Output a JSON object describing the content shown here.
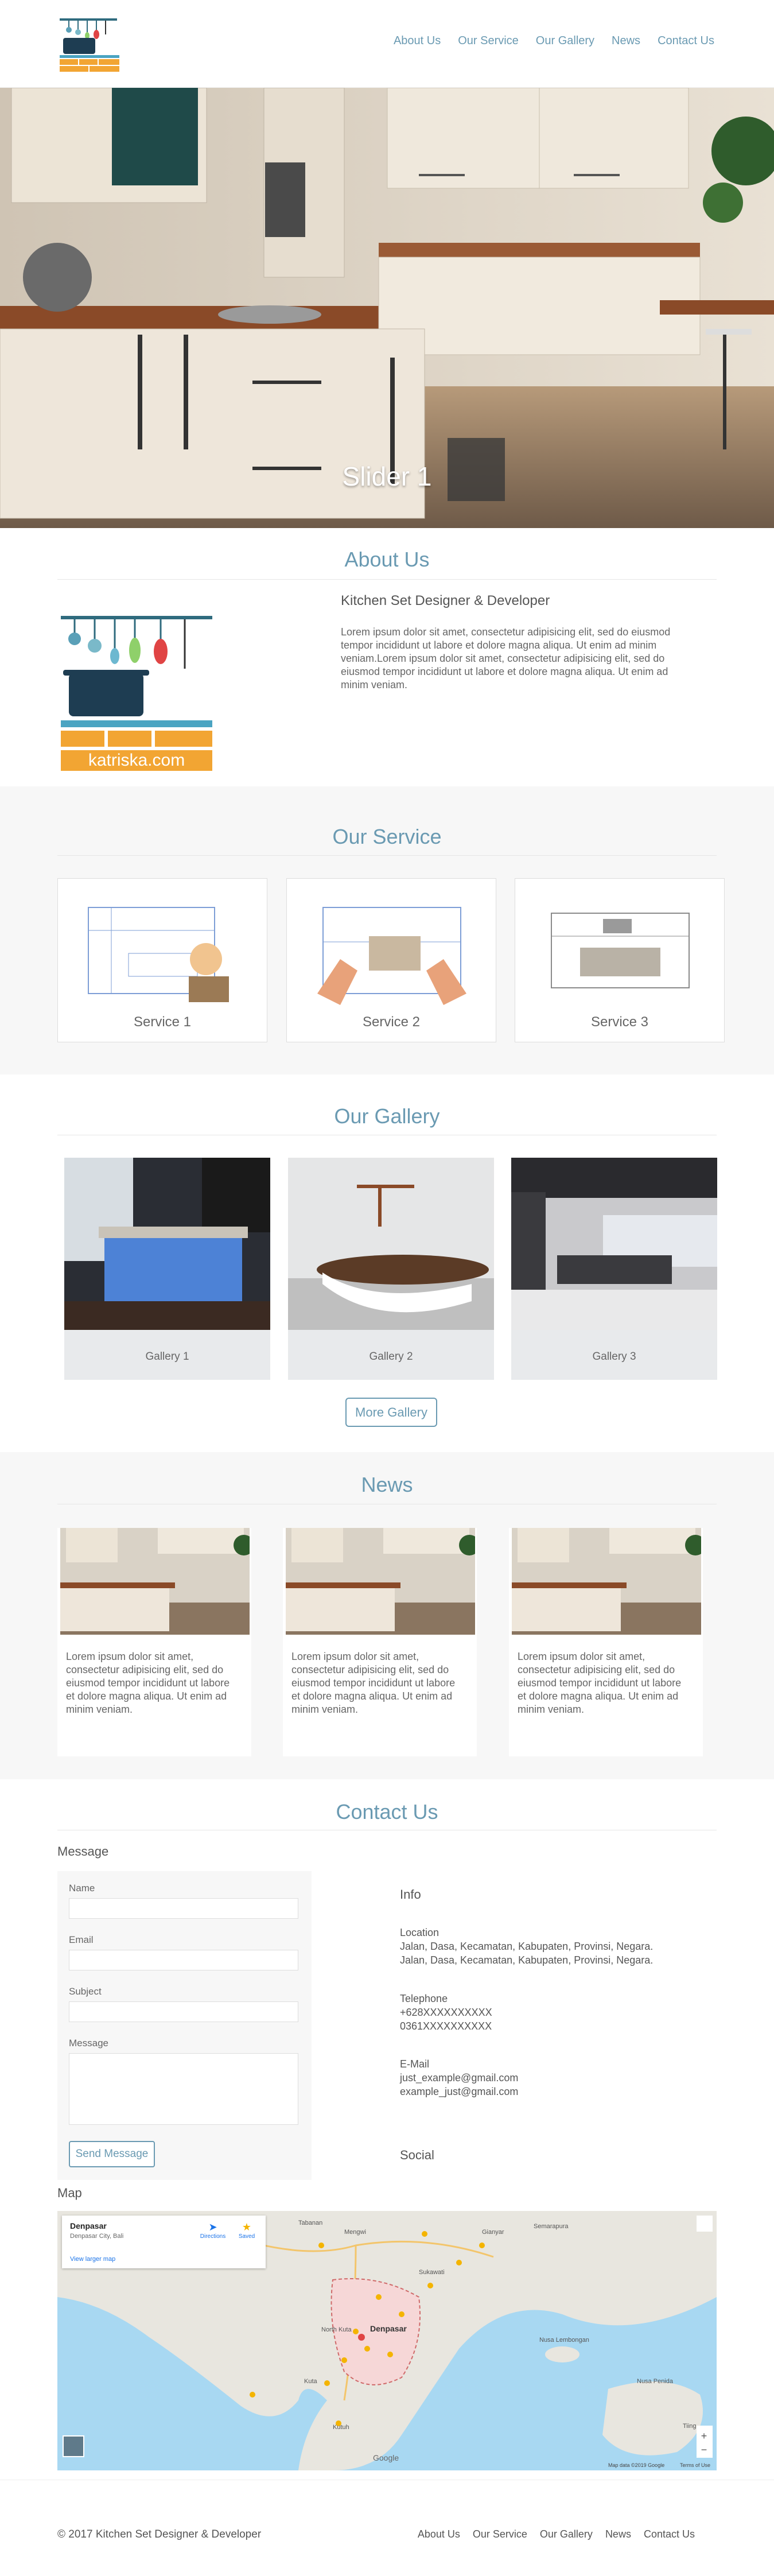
{
  "nav": {
    "items": [
      "About Us",
      "Our Service",
      "Our Gallery",
      "News",
      "Contact Us"
    ]
  },
  "hero": {
    "caption": "Slider 1"
  },
  "about": {
    "title": "About Us",
    "heading": "Kitchen Set Designer & Developer",
    "text": "Lorem ipsum dolor sit amet, consectetur adipisicing elit, sed do eiusmod tempor incididunt ut labore et dolore magna aliqua. Ut enim ad minim veniam.Lorem ipsum dolor sit amet, consectetur adipisicing elit, sed do eiusmod tempor incididunt ut labore et dolore magna aliqua. Ut enim ad minim veniam.",
    "logo_text": "katriska.com"
  },
  "service": {
    "title": "Our Service",
    "items": [
      "Service 1",
      "Service 2",
      "Service 3"
    ]
  },
  "gallery": {
    "title": "Our Gallery",
    "items": [
      "Gallery 1",
      "Gallery 2",
      "Gallery 3"
    ],
    "more_label": "More Gallery"
  },
  "news": {
    "title": "News",
    "items": [
      "Lorem ipsum dolor sit amet, consectetur adipisicing elit, sed do eiusmod tempor incididunt ut labore et dolore magna aliqua. Ut enim ad minim veniam.",
      "Lorem ipsum dolor sit amet, consectetur adipisicing elit, sed do eiusmod tempor incididunt ut labore et dolore magna aliqua. Ut enim ad minim veniam.",
      "Lorem ipsum dolor sit amet, consectetur adipisicing elit, sed do eiusmod tempor incididunt ut labore et dolore magna aliqua. Ut enim ad minim veniam."
    ]
  },
  "contact": {
    "title": "Contact Us",
    "message_heading": "Message",
    "fields": [
      "Name",
      "Email",
      "Subject",
      "Message"
    ],
    "send_label": "Send Message",
    "info_heading": "Info",
    "location_label": "Location",
    "location_lines": [
      "Jalan, Dasa, Kecamatan, Kabupaten, Provinsi, Negara.",
      "Jalan, Dasa, Kecamatan, Kabupaten, Provinsi, Negara."
    ],
    "telephone_label": "Telephone",
    "telephone_lines": [
      "+628XXXXXXXXXX",
      "0361XXXXXXXXXX"
    ],
    "email_label": "E-Mail",
    "email_lines": [
      "just_example@gmail.com",
      "example_just@gmail.com"
    ],
    "social_label": "Social",
    "map_heading": "Map"
  },
  "map": {
    "place_title": "Denpasar",
    "place_subtitle": "Denpasar City, Bali",
    "directions_label": "Directions",
    "save_label": "Saved",
    "larger_map": "View larger map",
    "city_label": "Denpasar",
    "labels": [
      "Tabanan",
      "Mengwi",
      "Gianyar",
      "Semarapura",
      "Sukawati",
      "North Kuta",
      "Kuta",
      "Nusa Lembongan",
      "Nusa Penida",
      "Kutuh",
      "Tiing"
    ],
    "attribution": "Map data ©2019 Google",
    "terms": "Terms of Use",
    "google": "Google",
    "zoom_in": "+",
    "zoom_out": "−"
  },
  "footer": {
    "copyright": "© 2017 Kitchen Set Designer & Developer",
    "items": [
      "About Us",
      "Our Service",
      "Our Gallery",
      "News",
      "Contact Us"
    ]
  },
  "colors": {
    "accent": "#6a9ab2",
    "section_bg": "#f7f7f7"
  }
}
